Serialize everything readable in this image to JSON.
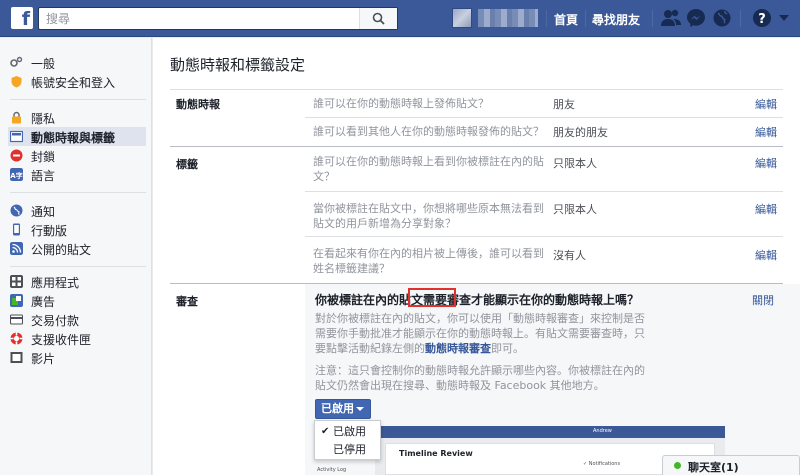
{
  "topbar": {
    "logo": "f",
    "search_placeholder": "搜尋",
    "nav_home": "首頁",
    "nav_find_friends": "尋找朋友",
    "icons": [
      "friends-icon",
      "messenger-icon",
      "globe-icon",
      "help-icon",
      "caret-down-icon"
    ]
  },
  "sidebar": {
    "groups": [
      [
        {
          "label": "一般",
          "icon": "gear-icon",
          "color": "#606770"
        },
        {
          "label": "帳號安全和登入",
          "icon": "shield-icon",
          "color": "#f5a623"
        }
      ],
      [
        {
          "label": "隱私",
          "icon": "lock-icon",
          "color": "#f5a623"
        },
        {
          "label": "動態時報與標籤",
          "icon": "timeline-icon",
          "color": "#4267b2",
          "active": true
        },
        {
          "label": "封鎖",
          "icon": "block-icon",
          "color": "#e0322d"
        },
        {
          "label": "語言",
          "icon": "language-icon",
          "color": "#4267b2"
        }
      ],
      [
        {
          "label": "通知",
          "icon": "globe-icon",
          "color": "#4267b2"
        },
        {
          "label": "行動版",
          "icon": "mobile-icon",
          "color": "#4267b2"
        },
        {
          "label": "公開的貼文",
          "icon": "rss-icon",
          "color": "#4267b2"
        }
      ],
      [
        {
          "label": "應用程式",
          "icon": "apps-icon",
          "color": "#4b4f56"
        },
        {
          "label": "廣告",
          "icon": "ads-icon",
          "color": "#42b72a"
        },
        {
          "label": "交易付款",
          "icon": "card-icon",
          "color": "#4b4f56"
        },
        {
          "label": "支援收件匣",
          "icon": "support-icon",
          "color": "#e0322d"
        },
        {
          "label": "影片",
          "icon": "video-icon",
          "color": "#4b4f56"
        }
      ]
    ]
  },
  "main": {
    "title": "動態時報和標籤設定",
    "sections": {
      "timeline": {
        "label": "動態時報",
        "rows": [
          {
            "question": "誰可以在你的動態時報上發佈貼文？",
            "value": "朋友",
            "edit": "編輯"
          },
          {
            "question": "誰可以看到其他人在你的動態時報發佈的貼文？",
            "value": "朋友的朋友",
            "edit": "編輯"
          }
        ]
      },
      "tagging": {
        "label": "標籤",
        "rows": [
          {
            "question": "誰可以在你的動態時報上看到你被標註在內的貼文？",
            "value": "只限本人",
            "edit": "編輯"
          },
          {
            "question": "當你被標註在貼文中，你想將哪些原本無法看到貼文的用戶新增為分享對象？",
            "value": "只限本人",
            "edit": "編輯"
          },
          {
            "question": "在看起來有你在內的相片被上傳後，誰可以看到姓名標籤建議？",
            "value": "沒有人",
            "edit": "編輯"
          }
        ]
      },
      "review": {
        "label": "審查",
        "question": "你被標註在內的貼文需要審查才能顯示在你的動態時報上嗎？",
        "close": "關閉",
        "desc_pre": "對於你被標註在內的貼文，你可以使用「動態時報審查」來控制是否需要你手動批准才能顯示在你的動態時報上。有貼文需要審查時，只要點擊活動紀錄左側的",
        "desc_link": "動態時報審查",
        "desc_post": "即可。",
        "note": "注意：這只會控制你的動態時報允許顯示哪些內容。你被標註在內的貼文仍然會出現在搜尋、動態時報及 Facebook 其他地方。",
        "dropdown": {
          "selected": "已啟用",
          "options": [
            "已啟用",
            "已停用"
          ]
        },
        "preview": {
          "title": "Timeline Review",
          "notifications": "✓ Notifications",
          "activity_log": "Activity Log",
          "name": "Andrew"
        }
      }
    }
  },
  "chat": {
    "label": "聊天室(1)"
  }
}
